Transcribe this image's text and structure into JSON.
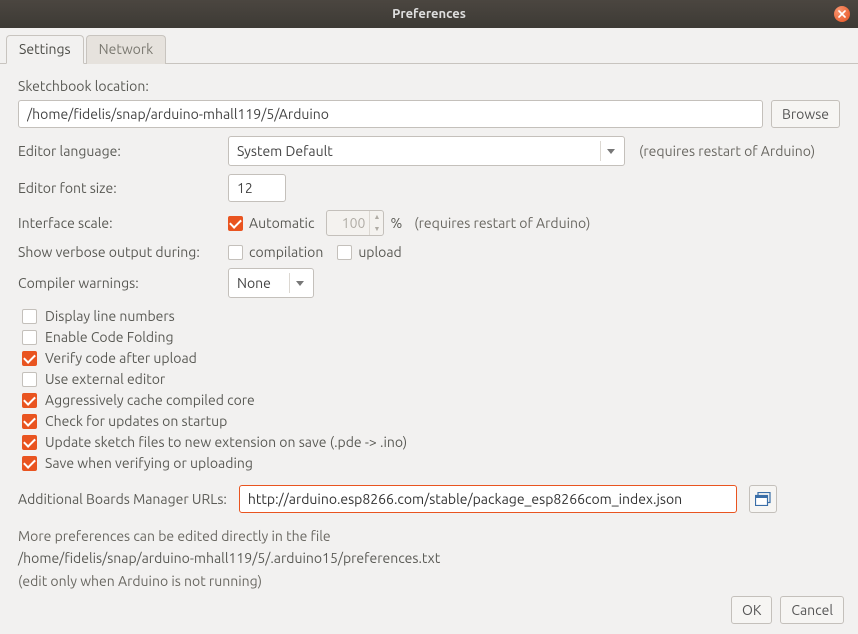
{
  "window": {
    "title": "Preferences"
  },
  "tabs": {
    "settings": "Settings",
    "network": "Network"
  },
  "sketchbook": {
    "label": "Sketchbook location:",
    "path": "/home/fidelis/snap/arduino-mhall119/5/Arduino",
    "browse": "Browse"
  },
  "language": {
    "label": "Editor language:",
    "value": "System Default",
    "note": "(requires restart of Arduino)"
  },
  "fontsize": {
    "label": "Editor font size:",
    "value": "12"
  },
  "scale": {
    "label": "Interface scale:",
    "auto": "Automatic",
    "value": "100",
    "percent": "%",
    "note": "(requires restart of Arduino)"
  },
  "verbose": {
    "label": "Show verbose output during:",
    "compilation": "compilation",
    "upload": "upload"
  },
  "warnings": {
    "label": "Compiler warnings:",
    "value": "None"
  },
  "checks": {
    "line_numbers": "Display line numbers",
    "code_folding": "Enable Code Folding",
    "verify_upload": "Verify code after upload",
    "external_editor": "Use external editor",
    "aggressive_cache": "Aggressively cache compiled core",
    "check_updates": "Check for updates on startup",
    "update_ext": "Update sketch files to new extension on save (.pde -> .ino)",
    "save_verify": "Save when verifying or uploading"
  },
  "urls": {
    "label": "Additional Boards Manager URLs:",
    "value": "http://arduino.esp8266.com/stable/package_esp8266com_index.json"
  },
  "prefs_note": {
    "line1": "More preferences can be edited directly in the file",
    "path": "/home/fidelis/snap/arduino-mhall119/5/.arduino15/preferences.txt",
    "line3": "(edit only when Arduino is not running)"
  },
  "buttons": {
    "ok": "OK",
    "cancel": "Cancel"
  }
}
